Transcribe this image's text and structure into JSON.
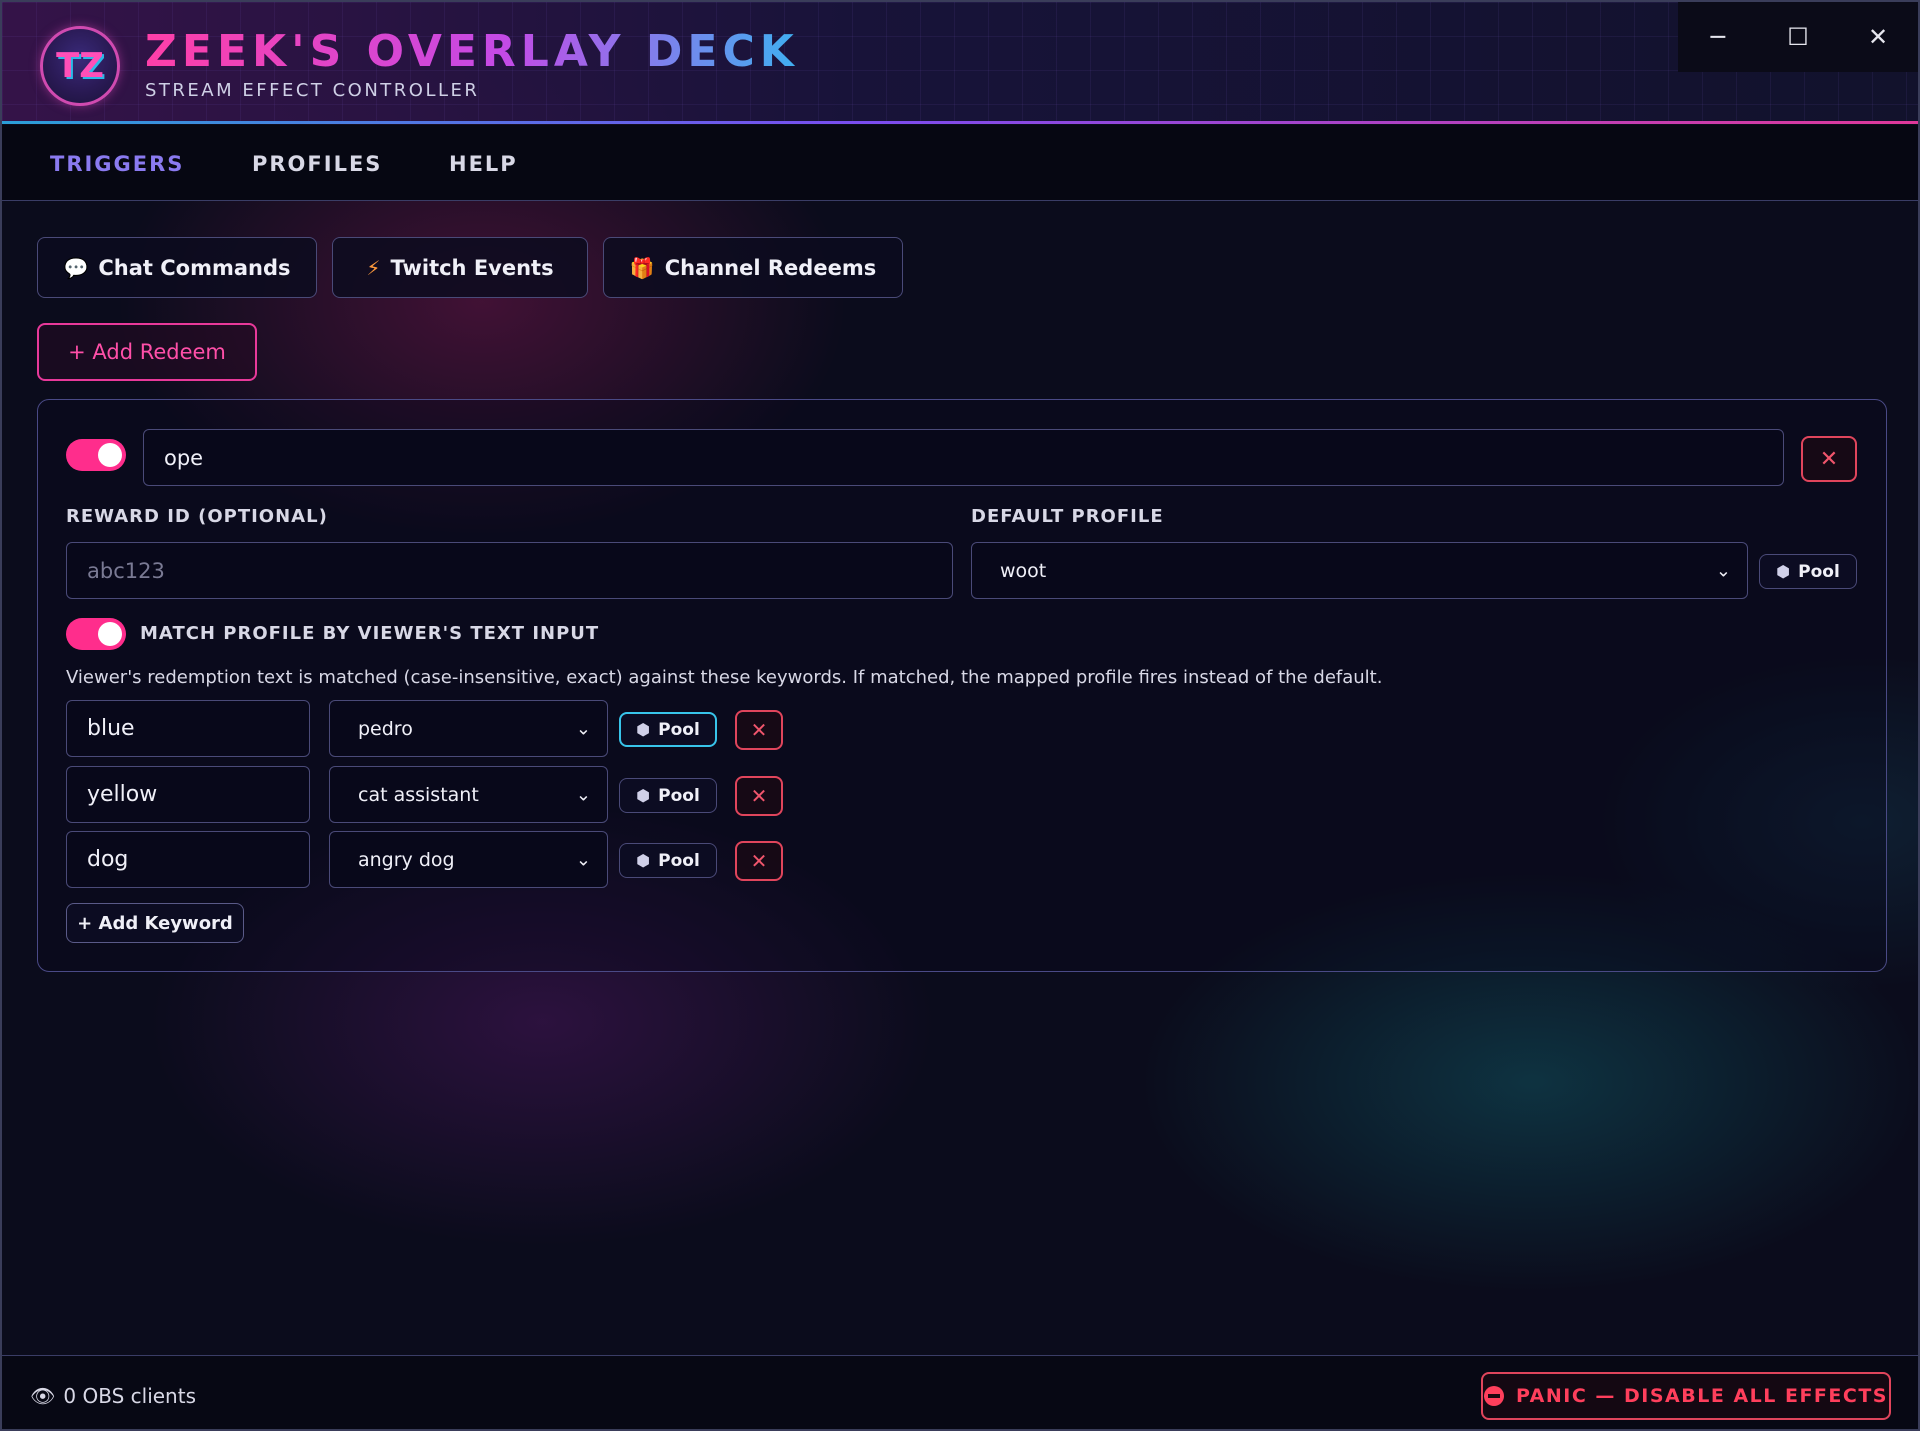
{
  "app": {
    "logo_text": "TZ",
    "title": "ZEEK'S OVERLAY DECK",
    "subtitle": "STREAM EFFECT CONTROLLER"
  },
  "window_controls": {
    "minimize": "─",
    "maximize": "☐",
    "close": "✕"
  },
  "nav": {
    "tabs": [
      {
        "label": "TRIGGERS",
        "active": true
      },
      {
        "label": "PROFILES",
        "active": false
      },
      {
        "label": "HELP",
        "active": false
      }
    ]
  },
  "subtabs": [
    {
      "label": "Chat Commands",
      "icon": "chat-bubble-icon",
      "glyph": "💬"
    },
    {
      "label": "Twitch Events",
      "icon": "lightning-icon",
      "glyph": "⚡"
    },
    {
      "label": "Channel Redeems",
      "icon": "gift-icon",
      "glyph": "🎁"
    }
  ],
  "add_redeem_label": "+ Add Redeem",
  "redeem": {
    "enabled": true,
    "name_value": "ope",
    "reward_id_label": "REWARD ID (OPTIONAL)",
    "reward_id_placeholder": "abc123",
    "default_profile_label": "DEFAULT PROFILE",
    "default_profile_value": "woot",
    "pool_label": "Pool",
    "match_enabled": true,
    "match_label": "MATCH PROFILE BY VIEWER'S TEXT INPUT",
    "help_text": "Viewer's redemption text is matched (case-insensitive, exact) against these keywords. If matched, the mapped profile fires instead of the default.",
    "keywords": [
      {
        "keyword": "blue",
        "profile": "pedro",
        "pool_label": "Pool",
        "pool_active": true
      },
      {
        "keyword": "yellow",
        "profile": "cat assistant",
        "pool_label": "Pool",
        "pool_active": false
      },
      {
        "keyword": "dog",
        "profile": "angry dog",
        "pool_label": "Pool",
        "pool_active": false
      }
    ],
    "add_keyword_label": "+ Add Keyword"
  },
  "footer": {
    "obs_clients": "0 OBS clients",
    "panic_label": "PANIC — DISABLE ALL EFFECTS"
  },
  "colors": {
    "accent_pink": "#ff2d8c",
    "accent_purple": "#8a7af0",
    "accent_cyan": "#38c4ea",
    "danger": "#e0455c"
  }
}
